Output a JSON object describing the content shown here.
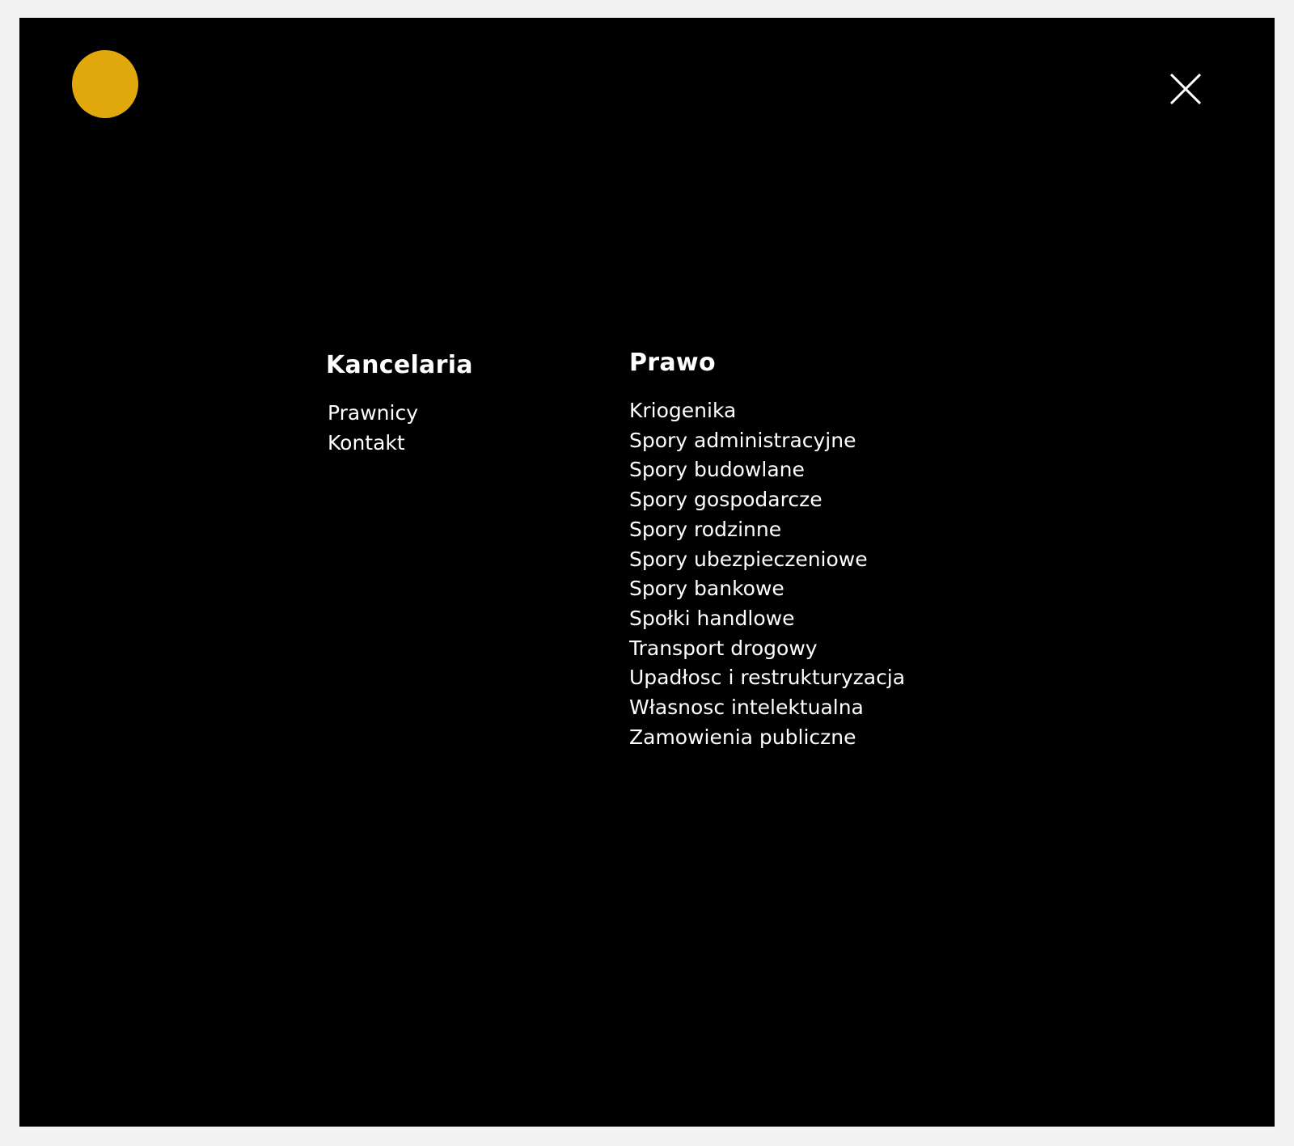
{
  "colors": {
    "page_background": "#f2f2f2",
    "menu_background": "#000000",
    "logo_accent": "#e0a80c",
    "text": "#ffffff"
  },
  "header": {
    "logo_icon": "circle-logo-icon",
    "close_icon": "close-icon"
  },
  "kancelaria": {
    "heading": "Kancelaria",
    "items": [
      "Prawnicy",
      "Kontakt"
    ]
  },
  "prawo": {
    "heading": "Prawo",
    "items": [
      "Kriogenika",
      "Spory administracyjne",
      "Spory budowlane",
      "Spory gospodarcze",
      "Spory rodzinne",
      "Spory ubezpieczeniowe",
      "Spory bankowe",
      "Społki handlowe",
      "Transport drogowy",
      "Upadłosc i restrukturyzacja",
      "Własnosc intelektualna",
      "Zamowienia publiczne"
    ]
  }
}
